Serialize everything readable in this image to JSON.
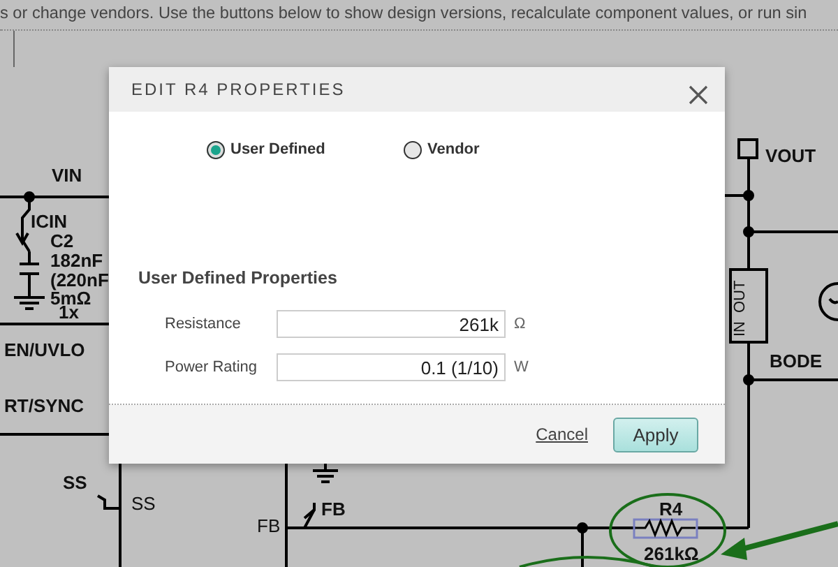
{
  "instructions": "s or change vendors. Use the buttons below to show design versions, recalculate component values, or run sin",
  "schematic": {
    "labels": [
      {
        "text": "VIN",
        "kind": "net"
      },
      {
        "text": "ICIN",
        "kind": "net"
      },
      {
        "text": "C2",
        "kind": "net"
      },
      {
        "text": "182nF",
        "kind": "net"
      },
      {
        "text": "(220nF",
        "kind": "net"
      },
      {
        "text": "5mΩ",
        "kind": "net"
      },
      {
        "text": "1x",
        "kind": "net"
      },
      {
        "text": "EN/UVLO",
        "kind": "net"
      },
      {
        "text": "RT/SYNC",
        "kind": "net"
      },
      {
        "text": "SS",
        "kind": "net"
      },
      {
        "text": "SS",
        "kind": "pin"
      },
      {
        "text": "FB",
        "kind": "net"
      },
      {
        "text": "FB",
        "kind": "pin"
      },
      {
        "text": "R4",
        "kind": "net"
      },
      {
        "text": "261kΩ",
        "kind": "net"
      },
      {
        "text": "VOUT",
        "kind": "net"
      },
      {
        "text": "IN",
        "kind": "port"
      },
      {
        "text": "OUT",
        "kind": "port"
      },
      {
        "text": "BODE",
        "kind": "net"
      }
    ]
  },
  "dialog": {
    "title": "EDIT R4 PROPERTIES",
    "radios": [
      {
        "label": "User Defined",
        "selected": true
      },
      {
        "label": "Vendor",
        "selected": false
      }
    ],
    "section_title": "User Defined Properties",
    "fields": [
      {
        "label": "Resistance",
        "value": "261k",
        "unit": "Ω"
      },
      {
        "label": "Power Rating",
        "value": "0.1 (1/10)",
        "unit": "W"
      }
    ],
    "cancel": "Cancel",
    "apply": "Apply"
  }
}
